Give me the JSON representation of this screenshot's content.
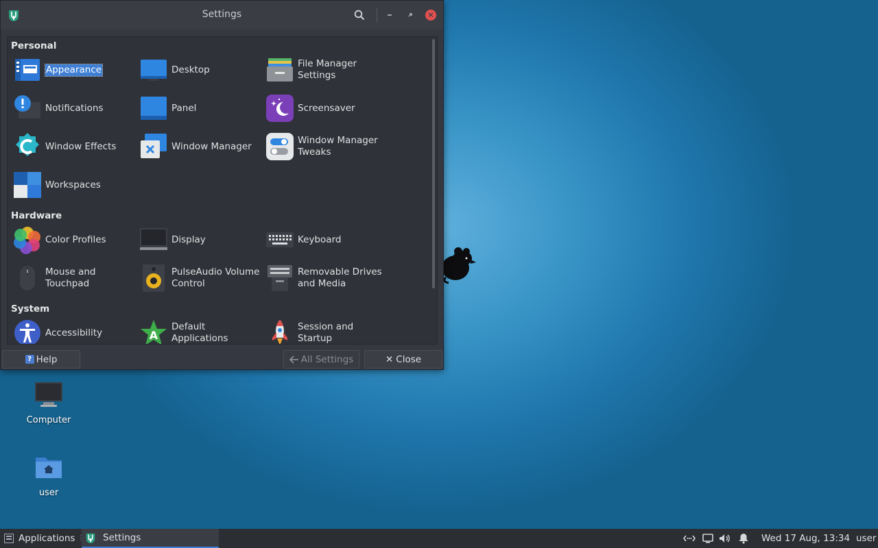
{
  "window": {
    "title": "Settings",
    "sections": [
      {
        "label": "Personal"
      },
      {
        "label": "Hardware"
      },
      {
        "label": "System"
      }
    ],
    "items": {
      "appearance": "Appearance",
      "desktop": "Desktop",
      "file_manager": "File Manager\nSettings",
      "notifications": "Notifications",
      "panel": "Panel",
      "screensaver": "Screensaver",
      "window_effects": "Window Effects",
      "window_manager": "Window Manager",
      "wm_tweaks": "Window Manager\nTweaks",
      "workspaces": "Workspaces",
      "color_profiles": "Color Profiles",
      "display": "Display",
      "keyboard": "Keyboard",
      "mouse": "Mouse and\nTouchpad",
      "pulseaudio": "PulseAudio Volume\nControl",
      "removable": "Removable Drives\nand Media",
      "accessibility": "Accessibility",
      "default_apps": "Default\nApplications",
      "session": "Session and\nStartup"
    },
    "buttons": {
      "help": "Help",
      "all_settings": "All Settings",
      "close": "Close"
    }
  },
  "desktop": {
    "icons": [
      {
        "label": "Computer"
      },
      {
        "label": "user"
      }
    ]
  },
  "taskbar": {
    "applications": "Applications",
    "task": "Settings",
    "clock": "Wed 17 Aug, 13:34",
    "user": "user"
  },
  "colors": {
    "accent": "#3e7fd4",
    "window_bg": "#353840",
    "close_red": "#e0504f"
  }
}
